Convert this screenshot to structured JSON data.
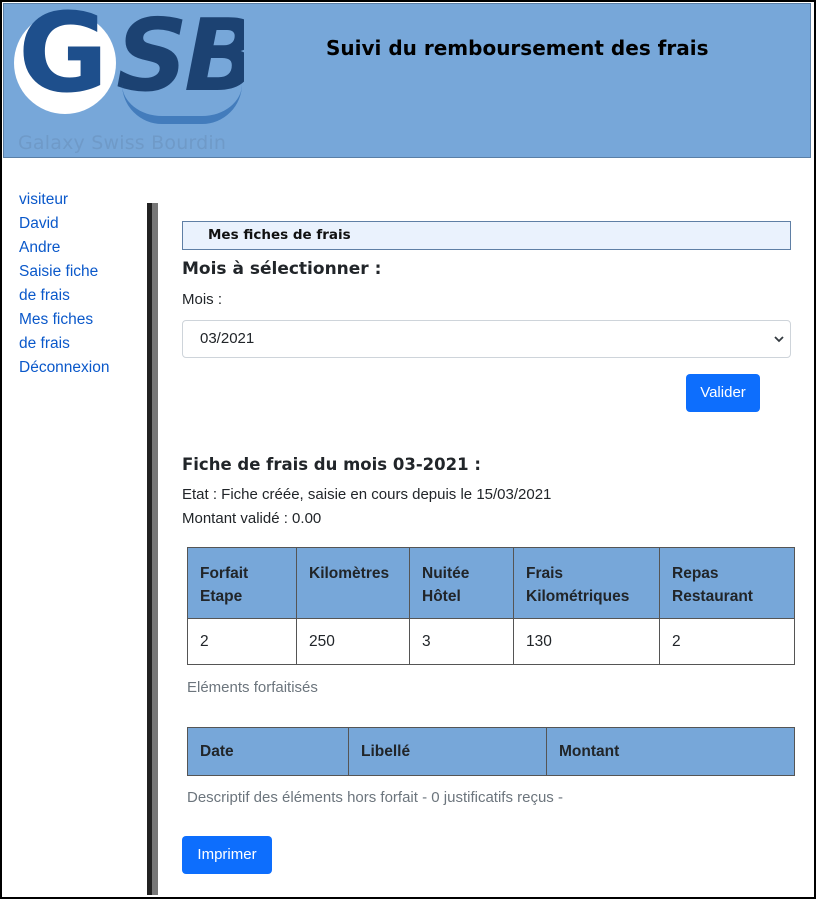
{
  "header": {
    "logo_letters": "GSB",
    "logo_tagline": "Galaxy Swiss Bourdin",
    "title": "Suivi du remboursement des frais"
  },
  "sidebar": {
    "items": [
      {
        "label": "visiteur"
      },
      {
        "label": "David"
      },
      {
        "label": "Andre"
      },
      {
        "label": "Saisie fiche"
      },
      {
        "label": "de frais"
      },
      {
        "label": "Mes fiches"
      },
      {
        "label": "de frais"
      },
      {
        "label": "Déconnexion"
      }
    ]
  },
  "main": {
    "section_title": "Mes fiches de frais",
    "month_heading": "Mois à sélectionner :",
    "month_label": "Mois :",
    "month_selected": "03/2021",
    "validate_label": "Valider",
    "sheet_heading": "Fiche de frais du mois 03-2021 :",
    "state_text": "Etat : Fiche créée, saisie en cours depuis le 15/03/2021",
    "amount_text": "Montant validé : 0.00",
    "forfait_table": {
      "headers": [
        "Forfait Etape",
        "Kilomètres",
        "Nuitée Hôtel",
        "Frais Kilométriques",
        "Repas Restaurant"
      ],
      "row": [
        "2",
        "250",
        "3",
        "130",
        "2"
      ],
      "caption": "Eléments forfaitisés"
    },
    "horsforfait_table": {
      "headers": [
        "Date",
        "Libellé",
        "Montant"
      ],
      "caption": "Descriptif des éléments hors forfait - 0 justificatifs reçus -"
    },
    "print_label": "Imprimer"
  },
  "colors": {
    "header_bg": "#77a7d9",
    "link": "#0a58ca",
    "primary_button": "#0d6efd",
    "section_header_bg": "#eaf2fd"
  }
}
